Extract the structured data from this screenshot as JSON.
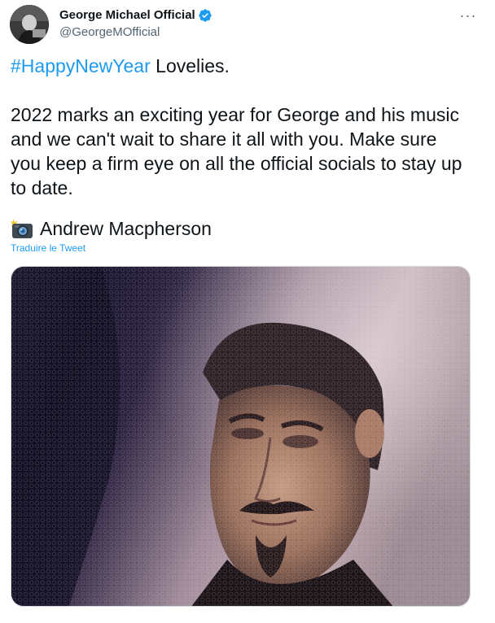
{
  "author": {
    "display_name": "George Michael Official",
    "handle": "@GeorgeMOfficial",
    "verified": true,
    "avatar_icon": "profile-avatar"
  },
  "more_label": "···",
  "tweet": {
    "hashtag": "#HappyNewYear",
    "greeting": " Lovelies.",
    "lines": [
      "2022 marks an exciting year for George and his music",
      "and we can't wait to share it all with you. Make sure",
      "you keep a firm eye on all the official socials to stay up",
      "to date."
    ],
    "credit_icon": "camera-flash-icon",
    "credit": "Andrew Macpherson"
  },
  "translate_label": "Traduire le Tweet",
  "colors": {
    "link": "#1d9bf0",
    "text": "#0f1419",
    "secondary": "#536471"
  }
}
